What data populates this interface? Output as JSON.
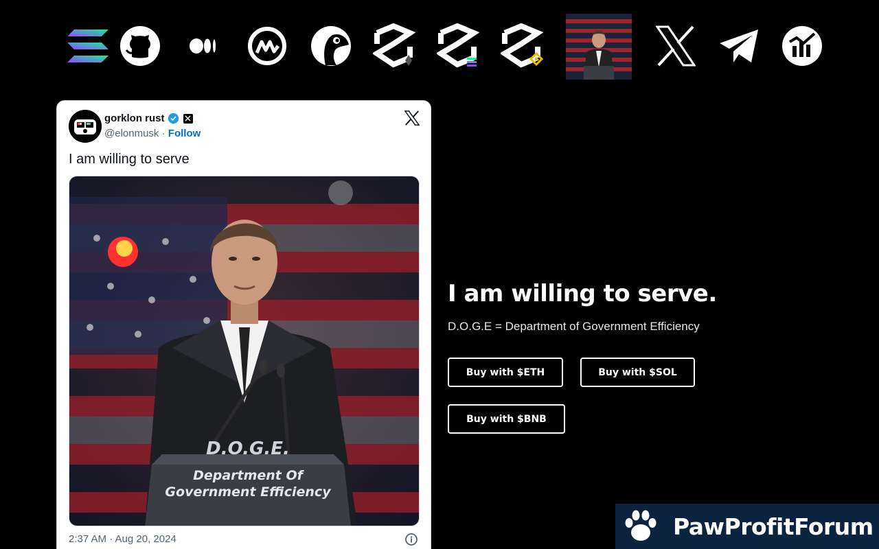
{
  "icons": [
    {
      "name": "solana-icon"
    },
    {
      "name": "github-icon"
    },
    {
      "name": "medium-icon"
    },
    {
      "name": "coinmarketcap-icon"
    },
    {
      "name": "coingecko-icon"
    },
    {
      "name": "dextools-eth-icon"
    },
    {
      "name": "dextools-sol-icon"
    },
    {
      "name": "dextools-bnb-icon"
    },
    {
      "name": "doge-portrait-thumbnail"
    },
    {
      "name": "x-icon"
    },
    {
      "name": "telegram-icon"
    },
    {
      "name": "dexscreener-icon"
    }
  ],
  "tweet": {
    "display_name": "gorklon rust",
    "handle": "@elonmusk",
    "separator": " · ",
    "follow_label": "Follow",
    "text": "I am willing to serve",
    "podium_top": "D.O.G.E.",
    "podium_line1": "Department Of",
    "podium_line2": "Government Efficiency",
    "timestamp": "2:37 AM · Aug 20, 2024"
  },
  "hero": {
    "title": "I am willing to serve.",
    "subtitle": "D.O.G.E = Department of Government Efficiency"
  },
  "buttons": {
    "eth": "Buy with $ETH",
    "sol": "Buy with $SOL",
    "bnb": "Buy with $BNB"
  },
  "watermark": {
    "text": "PawProfitForum"
  },
  "colors": {
    "background": "#000000",
    "card": "#ffffff",
    "link_blue": "#006fd6",
    "verified_blue": "#1d9bf0",
    "watermark_bg": "#0c2340"
  }
}
